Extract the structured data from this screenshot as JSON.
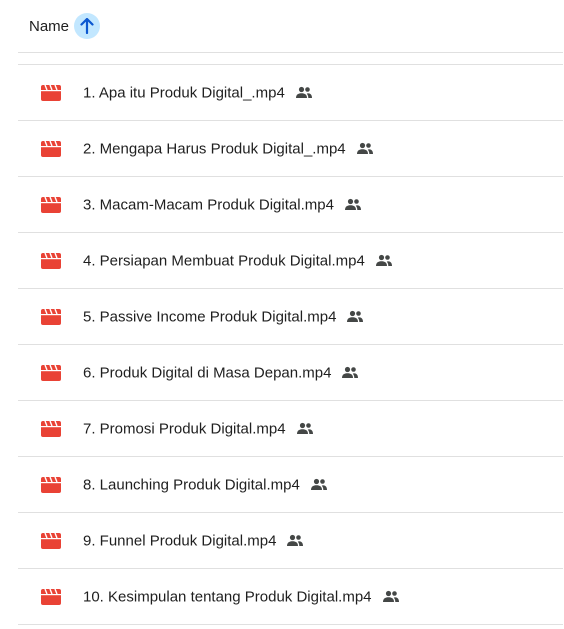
{
  "header": {
    "column_label": "Name",
    "sort_icon": "arrow-up-icon",
    "sort_button_color": "#c2e7ff",
    "sort_arrow_color": "#0b57d0"
  },
  "files": {
    "icon": "video-file-icon",
    "icon_color": "#e94235",
    "shared_icon": "people-icon",
    "items": [
      {
        "name": "1. Apa itu Produk Digital_.mp4"
      },
      {
        "name": "2. Mengapa Harus Produk Digital_.mp4"
      },
      {
        "name": "3. Macam-Macam Produk Digital.mp4"
      },
      {
        "name": "4. Persiapan Membuat Produk Digital.mp4"
      },
      {
        "name": "5. Passive Income Produk Digital.mp4"
      },
      {
        "name": "6. Produk Digital di Masa Depan.mp4"
      },
      {
        "name": "7. Promosi Produk Digital.mp4"
      },
      {
        "name": "8. Launching Produk Digital.mp4"
      },
      {
        "name": "9. Funnel Produk Digital.mp4"
      },
      {
        "name": "10. Kesimpulan tentang Produk Digital.mp4"
      }
    ]
  }
}
